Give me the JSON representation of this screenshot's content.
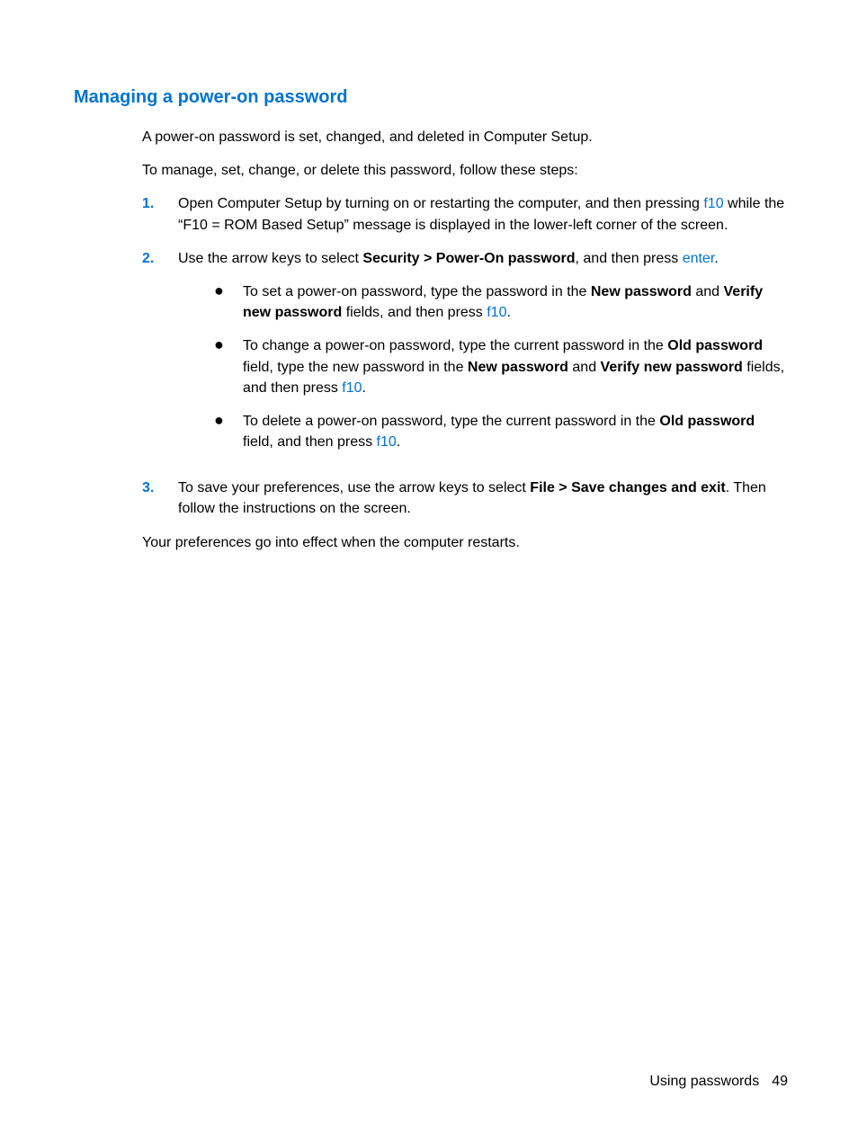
{
  "heading": "Managing a power-on password",
  "intro1": "A power-on password is set, changed, and deleted in Computer Setup.",
  "intro2": "To manage, set, change, or delete this password, follow these steps:",
  "steps": {
    "s1": {
      "num": "1.",
      "t1": "Open Computer Setup by turning on or restarting the computer, and then pressing ",
      "k1": "f10",
      "t2": " while the “F10 = ROM Based Setup” message is displayed in the lower-left corner of the screen."
    },
    "s2": {
      "num": "2.",
      "t1": "Use the arrow keys to select ",
      "b1": "Security > Power-On password",
      "t2": ", and then press ",
      "k1": "enter",
      "t3": "."
    },
    "s2a": {
      "t1": "To set a power-on password, type the password in the ",
      "b1": "New password",
      "t2": " and ",
      "b2": "Verify new password",
      "t3": " fields, and then press ",
      "k1": "f10",
      "t4": "."
    },
    "s2b": {
      "t1": "To change a power-on password, type the current password in the ",
      "b1": "Old password",
      "t2": " field, type the new password in the ",
      "b2": "New password",
      "t3": " and ",
      "b3": "Verify new password",
      "t4": " fields, and then press ",
      "k1": "f10",
      "t5": "."
    },
    "s2c": {
      "t1": "To delete a power-on password, type the current password in the ",
      "b1": "Old password",
      "t2": " field, and then press ",
      "k1": "f10",
      "t3": "."
    },
    "s3": {
      "num": "3.",
      "t1": "To save your preferences, use the arrow keys to select ",
      "b1": "File > Save changes and exit",
      "t2": ". Then follow the instructions on the screen."
    }
  },
  "outro": "Your preferences go into effect when the computer restarts.",
  "footer": {
    "label": "Using passwords",
    "page": "49"
  }
}
